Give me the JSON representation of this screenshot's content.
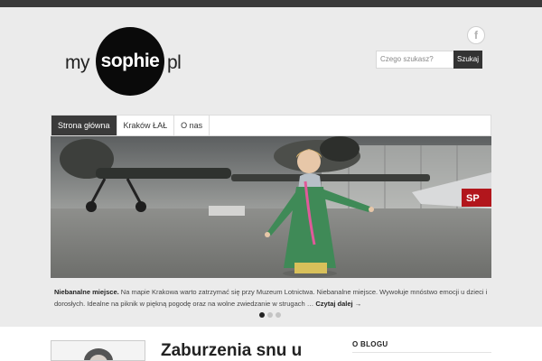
{
  "logo": {
    "my": "my",
    "sophie": "sophie",
    "pl": "pl"
  },
  "social": {
    "facebook_glyph": "f",
    "icon": "facebook-icon"
  },
  "search": {
    "placeholder": "Czego szukasz?",
    "button_label": "Szukaj"
  },
  "nav": {
    "items": [
      {
        "label": "Strona główna",
        "active": true
      },
      {
        "label": "Kraków ŁAŁ",
        "active": false
      },
      {
        "label": "O nas",
        "active": false
      }
    ]
  },
  "slider": {
    "caption_bold": "Niebanalne miejsce.",
    "caption_text": "Na mapie Krakowa warto zatrzymać się przy Muzeum Lotnictwa. Niebanalne miejsce. Wywołuje mnóstwo emocji u dzieci i dorosłych.  Idealne na piknik w piękną pogodę oraz na wolne zwiedzanie w strugach …",
    "more_label": "Czytaj dalej →",
    "slide_count": 3,
    "active_slide": 1
  },
  "post": {
    "title": "Zaburzenia snu u"
  },
  "sidebar": {
    "widget_title": "O BLOGU"
  },
  "colors": {
    "topbar": "#3a3a3a",
    "nav_active": "#3a3a3a",
    "page_bg": "#ebebeb"
  }
}
